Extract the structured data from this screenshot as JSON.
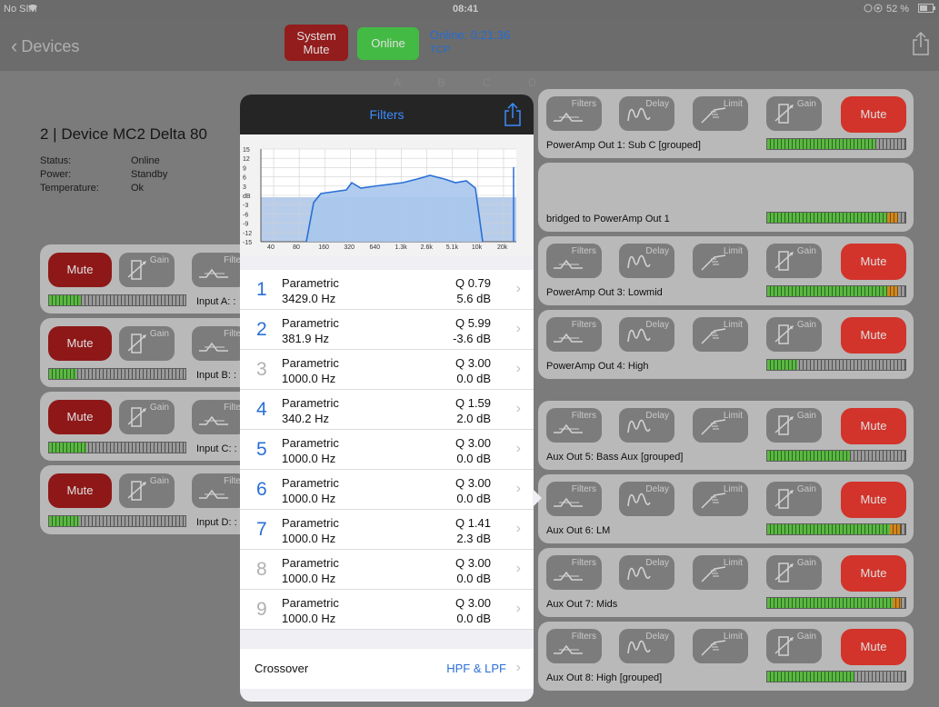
{
  "statusbar": {
    "carrier": "No SIM",
    "time": "08:41",
    "battery": "52 %"
  },
  "nav": {
    "back": "Devices",
    "system_mute": [
      "System",
      "Mute"
    ],
    "online": "Online",
    "online_time": "Online: 0:21:36",
    "protocol": "TCP"
  },
  "tabs": "A B C D",
  "device": {
    "title": "2 | Device MC2 Delta 80",
    "rows": [
      {
        "k": "Status:",
        "v": "Online"
      },
      {
        "k": "Power:",
        "v": "Standby"
      },
      {
        "k": "Temperature:",
        "v": "Ok"
      }
    ]
  },
  "inputs": [
    {
      "mute": "Mute",
      "gain": "Gain",
      "filters": "Filte",
      "name": "Input A: :",
      "level": 0.23
    },
    {
      "mute": "Mute",
      "gain": "Gain",
      "filters": "Filte",
      "name": "Input B: :",
      "level": 0.2
    },
    {
      "mute": "Mute",
      "gain": "Gain",
      "filters": "Filte",
      "name": "Input C: :",
      "level": 0.27
    },
    {
      "mute": "Mute",
      "gain": "Gain",
      "filters": "Filte",
      "name": "Input D: :",
      "level": 0.22
    }
  ],
  "outputs": [
    {
      "name": "PowerAmp Out 1: Sub C [grouped]",
      "level": 0.78,
      "peak": 0,
      "bridged": false
    },
    {
      "name": "bridged to PowerAmp Out 1",
      "level": 0.87,
      "peak": 0.08,
      "bridged": true
    },
    {
      "name": "PowerAmp Out 3: Lowmid",
      "level": 0.87,
      "peak": 0.08,
      "bridged": false
    },
    {
      "name": "PowerAmp Out 4: High",
      "level": 0.22,
      "peak": 0,
      "bridged": false
    },
    {
      "name": "Aux Out 5: Bass Aux [grouped]",
      "level": 0.6,
      "peak": 0,
      "bridged": false
    },
    {
      "name": "Aux Out 6: LM",
      "level": 0.89,
      "peak": 0.08,
      "bridged": false
    },
    {
      "name": "Aux Out 7: Mids",
      "level": 0.91,
      "peak": 0.06,
      "bridged": false
    },
    {
      "name": "Aux Out 8: High [grouped]",
      "level": 0.63,
      "peak": 0,
      "bridged": false
    }
  ],
  "labels": {
    "filters": "Filters",
    "delay": "Delay",
    "limit": "Limit",
    "gain": "Gain",
    "mute": "Mute"
  },
  "popover": {
    "title": "Filters",
    "graph": {
      "y_ticks": [
        "15",
        "12",
        "9",
        "6",
        "3",
        "dB",
        "-3",
        "-6",
        "-9",
        "-12",
        "-15"
      ],
      "x_ticks": [
        "40",
        "80",
        "160",
        "320",
        "640",
        "1.3k",
        "2.6k",
        "5.1k",
        "10k",
        "20k"
      ]
    },
    "filters": [
      {
        "n": "1",
        "type": "Parametric",
        "freq": "3429.0 Hz",
        "q": "Q 0.79",
        "gain": "5.6 dB",
        "active": true
      },
      {
        "n": "2",
        "type": "Parametric",
        "freq": "381.9 Hz",
        "q": "Q 5.99",
        "gain": "-3.6 dB",
        "active": true
      },
      {
        "n": "3",
        "type": "Parametric",
        "freq": "1000.0 Hz",
        "q": "Q 3.00",
        "gain": "0.0 dB",
        "active": false
      },
      {
        "n": "4",
        "type": "Parametric",
        "freq": "340.2 Hz",
        "q": "Q 1.59",
        "gain": "2.0 dB",
        "active": true
      },
      {
        "n": "5",
        "type": "Parametric",
        "freq": "1000.0 Hz",
        "q": "Q 3.00",
        "gain": "0.0 dB",
        "active": true
      },
      {
        "n": "6",
        "type": "Parametric",
        "freq": "1000.0 Hz",
        "q": "Q 3.00",
        "gain": "0.0 dB",
        "active": true
      },
      {
        "n": "7",
        "type": "Parametric",
        "freq": "1000.0 Hz",
        "q": "Q 1.41",
        "gain": "2.3 dB",
        "active": true
      },
      {
        "n": "8",
        "type": "Parametric",
        "freq": "1000.0 Hz",
        "q": "Q 3.00",
        "gain": "0.0 dB",
        "active": false
      },
      {
        "n": "9",
        "type": "Parametric",
        "freq": "1000.0 Hz",
        "q": "Q 3.00",
        "gain": "0.0 dB",
        "active": false
      }
    ],
    "crossover": {
      "label": "Crossover",
      "value": "HPF & LPF"
    }
  },
  "colors": {
    "accent": "#2a6fd6",
    "mute_active": "#f03b30",
    "mute_dark": "#a21c1c",
    "online": "#4dd44d",
    "meter_green": "#6ad14a",
    "meter_peak": "#f09a20"
  }
}
